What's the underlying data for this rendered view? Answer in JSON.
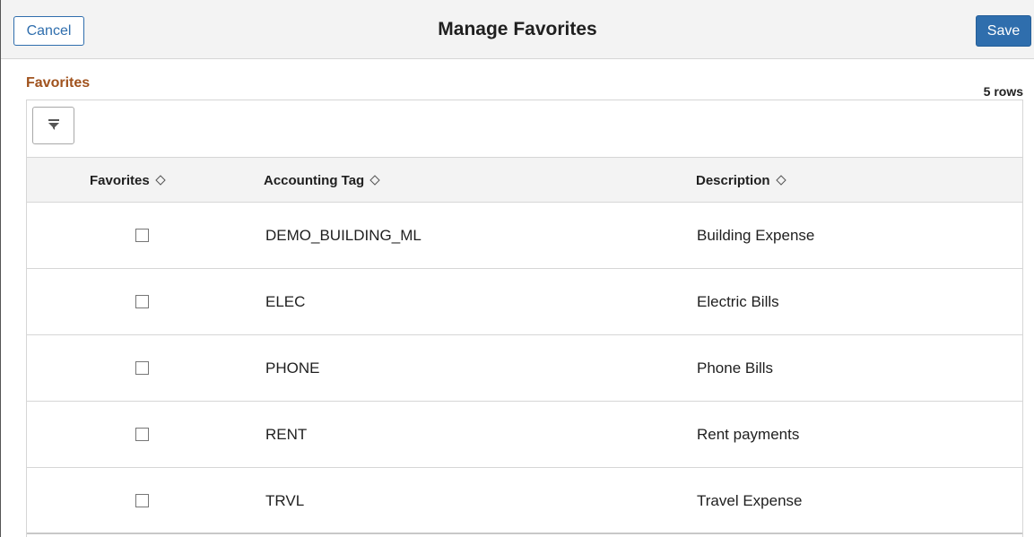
{
  "header": {
    "title": "Manage Favorites",
    "cancel_label": "Cancel",
    "save_label": "Save"
  },
  "section": {
    "title": "Favorites",
    "row_count": "5 rows"
  },
  "table": {
    "columns": [
      "Favorites",
      "Accounting Tag",
      "Description"
    ],
    "rows": [
      {
        "favorite": false,
        "tag": "DEMO_BUILDING_ML",
        "description": "Building Expense"
      },
      {
        "favorite": false,
        "tag": "ELEC",
        "description": "Electric Bills"
      },
      {
        "favorite": false,
        "tag": "PHONE",
        "description": "Phone Bills"
      },
      {
        "favorite": false,
        "tag": "RENT",
        "description": "Rent payments"
      },
      {
        "favorite": false,
        "tag": "TRVL",
        "description": "Travel Expense"
      }
    ]
  },
  "icons": {
    "filter": "filter-icon",
    "sort": "sort-toggle-icon"
  },
  "colors": {
    "accent": "#2f6ead",
    "section_title": "#a0521d",
    "header_bg": "#f3f3f3"
  }
}
